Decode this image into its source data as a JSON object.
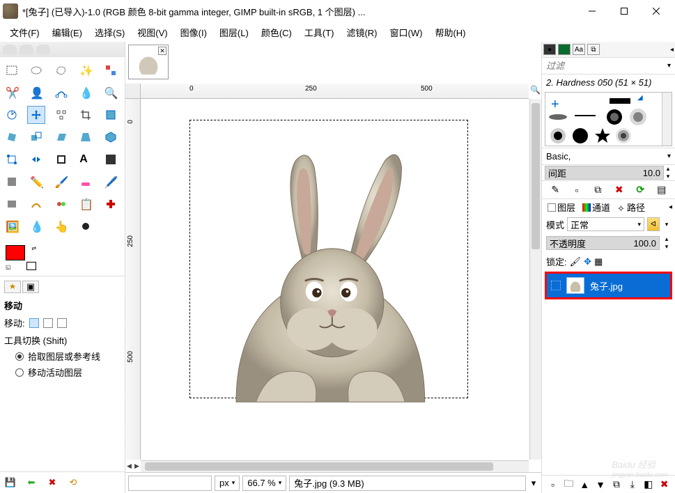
{
  "window": {
    "title": "*[兔子] (已导入)-1.0 (RGB 颜色 8-bit gamma integer, GIMP built-in sRGB, 1 个图层) ..."
  },
  "menu": {
    "file": "文件(F)",
    "edit": "编辑(E)",
    "select": "选择(S)",
    "view": "视图(V)",
    "image": "图像(I)",
    "layer": "图层(L)",
    "color": "颜色(C)",
    "tools": "工具(T)",
    "filters": "滤镜(R)",
    "window": "窗口(W)",
    "help": "帮助(H)"
  },
  "ruler": {
    "h": [
      "0",
      "250",
      "500"
    ],
    "v": [
      "0",
      "250",
      "500"
    ]
  },
  "tool_options": {
    "title": "移动",
    "move_label": "移动:",
    "switch_label": "工具切换 (Shift)",
    "radio1": "拾取图层或参考线",
    "radio2": "移动活动图层"
  },
  "status": {
    "unit": "px",
    "zoom": "66.7 %",
    "file": "兔子.jpg (9.3 MB)"
  },
  "brushes": {
    "filter_placeholder": "过滤",
    "current": "2. Hardness 050 (51 × 51)",
    "preset": "Basic,",
    "spacing_label": "间距",
    "spacing_value": "10.0"
  },
  "layers": {
    "tab_layers": "图层",
    "tab_channels": "通道",
    "tab_paths": "路径",
    "mode_label": "模式",
    "mode_value": "正常",
    "opacity_label": "不透明度",
    "opacity_value": "100.0",
    "lock_label": "锁定:",
    "item_name": "兔子.jpg"
  },
  "watermark": {
    "brand": "Baidu 经验",
    "url": "jingyan.baidu.com"
  },
  "colors": {
    "fg": "#ff0000",
    "bg": "#ffffff",
    "selection": "#0a6dd6",
    "highlight_border": "#ff0000"
  }
}
